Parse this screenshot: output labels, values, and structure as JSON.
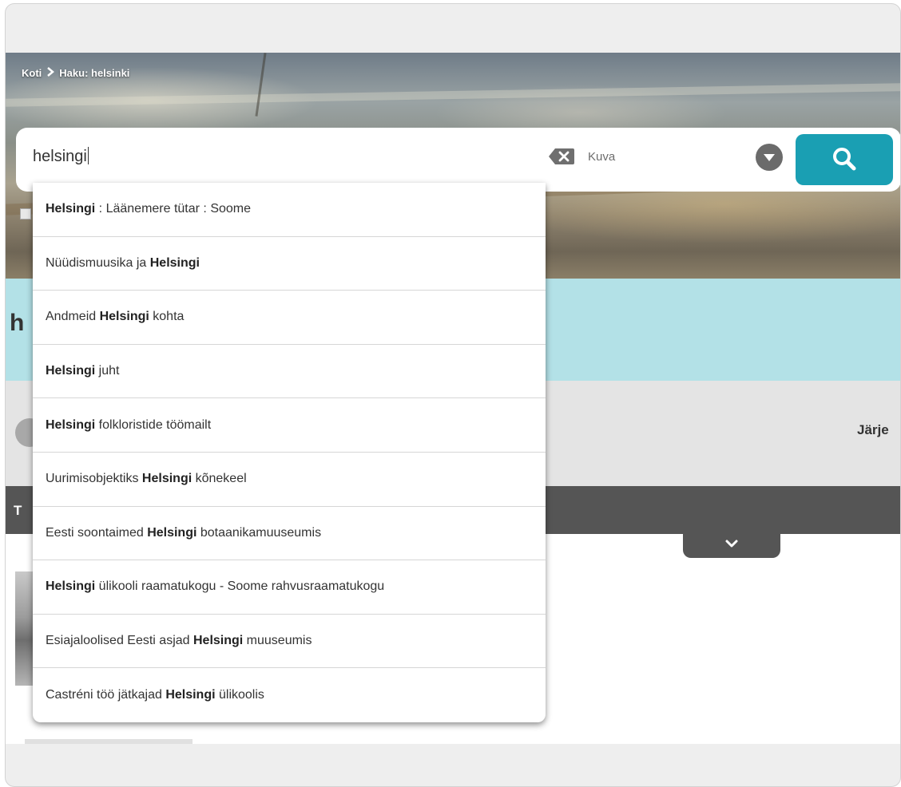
{
  "breadcrumb": {
    "home": "Koti",
    "current": "Haku: helsinki"
  },
  "search": {
    "query": "helsingi",
    "type_label": "Kuva"
  },
  "page": {
    "heading_fragment": "h",
    "sort_fragment": "Järje",
    "dark_band_fragment": "T"
  },
  "suggestions": [
    {
      "before": "",
      "bold": "Helsingi",
      "after": " : Läänemere tütar : Soome"
    },
    {
      "before": "Nüüdismuusika ja ",
      "bold": "Helsingi",
      "after": ""
    },
    {
      "before": "Andmeid ",
      "bold": "Helsingi",
      "after": " kohta"
    },
    {
      "before": "",
      "bold": "Helsingi",
      "after": " juht"
    },
    {
      "before": "",
      "bold": "Helsingi",
      "after": " folkloristide töömailt"
    },
    {
      "before": "Uurimisobjektiks ",
      "bold": "Helsingi",
      "after": " kõnekeel"
    },
    {
      "before": "Eesti soontaimed ",
      "bold": "Helsingi",
      "after": " botaanikamuuseumis"
    },
    {
      "before": "",
      "bold": "Helsingi",
      "after": " ülikooli raamatukogu - Soome rahvusraamatukogu"
    },
    {
      "before": "Esiajaloolised Eesti asjad ",
      "bold": "Helsingi",
      "after": " muuseumis"
    },
    {
      "before": "Castréni töö jätkajad ",
      "bold": "Helsingi",
      "after": " ülikoolis"
    }
  ],
  "colors": {
    "accent": "#1a9fb3",
    "band_cyan": "#b3e1e7",
    "band_dark": "#555555"
  },
  "icons": {
    "breadcrumb_separator": "chevron-right-icon",
    "clear": "clear-x-icon",
    "dropdown": "dropdown-arrow-icon",
    "search": "magnifier-icon",
    "expand": "chevron-down-icon"
  }
}
